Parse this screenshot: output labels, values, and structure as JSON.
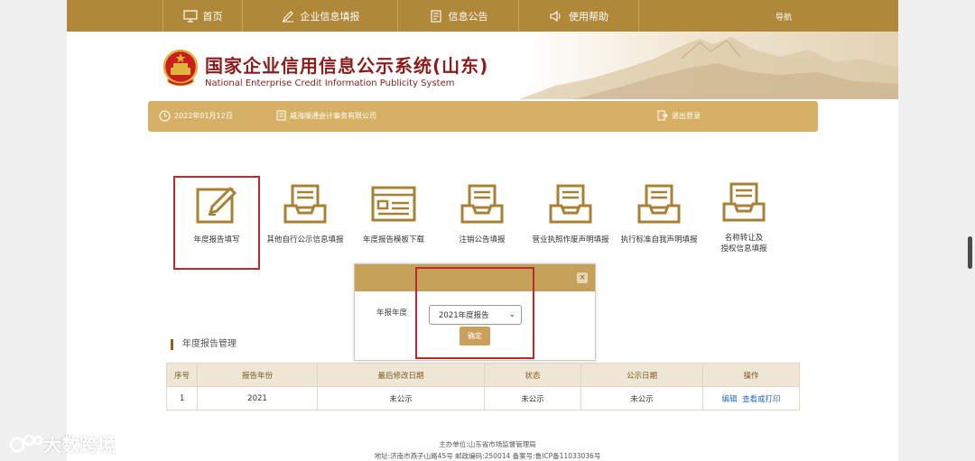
{
  "nav": {
    "items": [
      {
        "label": "首页",
        "icon": "monitor-icon"
      },
      {
        "label": "企业信息填报",
        "icon": "pen-icon"
      },
      {
        "label": "信息公告",
        "icon": "document-icon"
      },
      {
        "label": "使用帮助",
        "icon": "speaker-icon"
      }
    ],
    "right_label": "导航"
  },
  "header": {
    "title": "国家企业信用信息公示系统(山东)",
    "subtitle": "National Enterprise Credit Information Publicity System"
  },
  "infobar": {
    "date": "2022年01月12日",
    "company": "威海顺通会计事务有限公司",
    "logout": "退出登录"
  },
  "tiles": [
    {
      "label": "年度报告填写",
      "icon": "edit-document-icon"
    },
    {
      "label": "其他自行公示信息填报",
      "icon": "inbox-icon"
    },
    {
      "label": "年度报告模板下载",
      "icon": "template-icon"
    },
    {
      "label": "注销公告填报",
      "icon": "inbox-icon"
    },
    {
      "label": "营业执照作废声明填报",
      "icon": "inbox-icon"
    },
    {
      "label": "执行标准自我声明填报",
      "icon": "inbox-icon"
    },
    {
      "label": "名称转让及\n授权信息填报",
      "icon": "inbox-icon"
    }
  ],
  "section": {
    "title": "年度报告管理"
  },
  "table": {
    "headers": [
      "序号",
      "报告年份",
      "最后修改日期",
      "状态",
      "公示日期",
      "操作"
    ],
    "rows": [
      {
        "no": "1",
        "year": "2021",
        "modified": "未公示",
        "status": "未公示",
        "pub_date": "未公示",
        "edit": "编辑",
        "view": "查看或打印"
      }
    ]
  },
  "modal": {
    "label": "年报年度",
    "selected": "2021年度报告",
    "confirm": "确定",
    "close": "×"
  },
  "footer": {
    "line1": "主办单位:山东省市场监督管理局",
    "line2": "地址:济南市燕子山路45号    邮政编码:250014    备案号:鲁ICP备11033036号"
  },
  "watermark": {
    "text": "大数跨境"
  },
  "colors": {
    "brand": "#b0883a",
    "infobar": "#d6b065",
    "highlight": "#c0282d",
    "link": "#2a6bb6"
  }
}
